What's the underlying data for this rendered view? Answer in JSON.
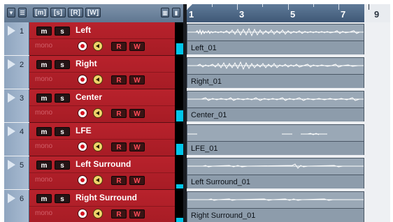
{
  "header": {
    "buttons": [
      {
        "id": "collapse",
        "label": "▼"
      },
      {
        "id": "view",
        "label": "☰"
      },
      {
        "id": "group-m",
        "label": "[m]"
      },
      {
        "id": "group-s",
        "label": "[s]"
      },
      {
        "id": "group-r",
        "label": "[R]"
      },
      {
        "id": "group-w",
        "label": "[W]"
      },
      {
        "id": "lanes",
        "label": "▥"
      },
      {
        "id": "info",
        "label": "▮"
      }
    ]
  },
  "ruler": {
    "labels": [
      "1",
      "3",
      "5",
      "7",
      "9"
    ]
  },
  "tracks": [
    {
      "number": "1",
      "name": "Left",
      "mode": "mono",
      "mute": "m",
      "solo": "s",
      "read": "R",
      "write": "W",
      "event": "Left_01",
      "meter_level": 0.65
    },
    {
      "number": "2",
      "name": "Right",
      "mode": "mono",
      "mute": "m",
      "solo": "s",
      "read": "R",
      "write": "W",
      "event": "Right_01",
      "meter_level": 0.0
    },
    {
      "number": "3",
      "name": "Center",
      "mode": "mono",
      "mute": "m",
      "solo": "s",
      "read": "R",
      "write": "W",
      "event": "Center_01",
      "meter_level": 0.65
    },
    {
      "number": "4",
      "name": "LFE",
      "mode": "mono",
      "mute": "m",
      "solo": "s",
      "read": "R",
      "write": "W",
      "event": "LFE_01",
      "meter_level": 0.65
    },
    {
      "number": "5",
      "name": "Left Surround",
      "mode": "mono",
      "mute": "m",
      "solo": "s",
      "read": "R",
      "write": "W",
      "event": "Left Surround_01",
      "meter_level": 0.2
    },
    {
      "number": "6",
      "name": "Right Surround",
      "mode": "mono",
      "mute": "m",
      "solo": "s",
      "read": "R",
      "write": "W",
      "event": "Right Surround_01",
      "meter_level": 0.2
    }
  ],
  "colors": {
    "track_red": "#b8222c",
    "meter": "#00c6ea",
    "event": "#9aa8b6"
  }
}
